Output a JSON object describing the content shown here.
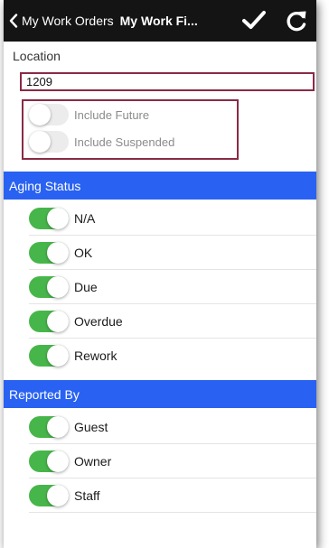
{
  "header": {
    "back_label": "My Work Orders",
    "title": "My Work Fi..."
  },
  "location": {
    "label": "Location",
    "value": "1209"
  },
  "options": [
    {
      "label": "Include Future",
      "on": false
    },
    {
      "label": "Include Suspended",
      "on": false
    }
  ],
  "aging_status": {
    "header": "Aging Status",
    "items": [
      {
        "label": "N/A",
        "on": true
      },
      {
        "label": "OK",
        "on": true
      },
      {
        "label": "Due",
        "on": true
      },
      {
        "label": "Overdue",
        "on": true
      },
      {
        "label": "Rework",
        "on": true
      }
    ]
  },
  "reported_by": {
    "header": "Reported By",
    "items": [
      {
        "label": "Guest",
        "on": true
      },
      {
        "label": "Owner",
        "on": true
      },
      {
        "label": "Staff",
        "on": true
      }
    ]
  },
  "colors": {
    "top_bar": "#141414",
    "section_header": "#2962f2",
    "toggle_on": "#47b64a",
    "highlight_box": "#8a2a45"
  },
  "icons": {
    "back": "chevron-left-icon",
    "save": "checkmark-icon",
    "refresh": "refresh-icon"
  }
}
